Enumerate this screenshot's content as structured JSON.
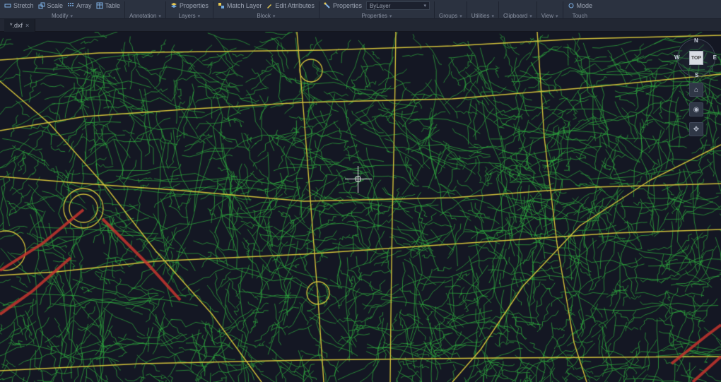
{
  "ribbon": {
    "panels": [
      {
        "title": "Modify",
        "items": [
          {
            "icon": "stretch-icon",
            "label": "Stretch"
          },
          {
            "icon": "scale-icon",
            "label": "Scale"
          },
          {
            "icon": "array-icon",
            "label": "Array"
          },
          {
            "icon": "table-icon",
            "label": "Table"
          }
        ]
      },
      {
        "title": "Annotation",
        "items": []
      },
      {
        "title": "Layers",
        "items": [
          {
            "icon": "layer-props-icon",
            "label": "Properties"
          }
        ]
      },
      {
        "title": "Block",
        "items": [
          {
            "icon": "match-layer-icon",
            "label": "Match Layer"
          },
          {
            "icon": "edit-attr-icon",
            "label": "Edit Attributes"
          }
        ]
      },
      {
        "title": "Properties",
        "items": [
          {
            "icon": "match-icon",
            "label": "Properties"
          }
        ],
        "combo": "ByLayer"
      },
      {
        "title": "Groups",
        "items": []
      },
      {
        "title": "Utilities",
        "items": []
      },
      {
        "title": "Clipboard",
        "items": []
      },
      {
        "title": "View",
        "items": []
      },
      {
        "title": "Touch",
        "items": [
          {
            "icon": "mode-icon",
            "label": "Mode"
          }
        ]
      }
    ]
  },
  "tab": {
    "name": "*.dxf",
    "close": "×"
  },
  "viewcube": {
    "face": "TOP",
    "n": "N",
    "s": "S",
    "e": "E",
    "w": "W"
  },
  "colors": {
    "major": "#d3c23a",
    "minor": "#2fae3f",
    "highway": "#c6352e",
    "bg": "#141723"
  }
}
